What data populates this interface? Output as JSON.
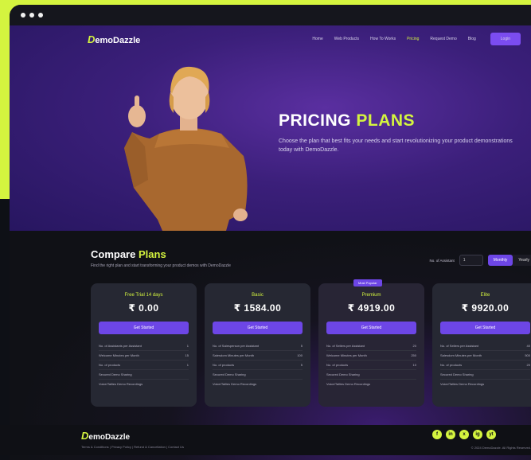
{
  "brand": {
    "logo_d": "D",
    "logo_rest": "emoDazzle"
  },
  "nav": {
    "links": [
      "Home",
      "Web Products",
      "How To Works",
      "Pricing",
      "Request Demo",
      "Blog"
    ],
    "login": "Login"
  },
  "hero": {
    "title_main": "PRICING",
    "title_accent": "PLANS",
    "subtitle": "Choose the plan that best fits your needs and start revolutionizing your product demonstrations today with DemoDazzle."
  },
  "compare": {
    "title_main": "Compare",
    "title_accent": "Plans",
    "subtitle": "Find the right plan and start transforming your product demos with DemoDazzle",
    "assistants_label": "No. of Assistant",
    "assistants_value": "1",
    "toggle": [
      "Monthly",
      "Yearly"
    ]
  },
  "plans": [
    {
      "name": "Free Trial 14 days",
      "price": "₹ 0.00",
      "cta": "Get Started",
      "features": [
        [
          "No. of Assistants per Assistant",
          "1"
        ],
        [
          "Welcome Minutes per Month",
          "15"
        ],
        [
          "No. of products",
          "1"
        ],
        [
          "Secured Demo Sharing",
          ""
        ],
        [
          "Voice/Tallies Demo Recordings",
          ""
        ]
      ]
    },
    {
      "name": "Basic",
      "price": "₹ 1584.00",
      "cta": "Get Started",
      "features": [
        [
          "No. of Salesperson per Assistant",
          "5"
        ],
        [
          "Salesdom Minutes per Month",
          "100"
        ],
        [
          "No. of products",
          "5"
        ],
        [
          "Secured Demo Sharing",
          ""
        ],
        [
          "Voice/Tallies Demo Recordings",
          ""
        ]
      ]
    },
    {
      "name": "Premium",
      "price": "₹ 4919.00",
      "cta": "Get Started",
      "badge": "Most Popular",
      "features": [
        [
          "No. of Sellers per Assistant",
          "20"
        ],
        [
          "Welcome Minutes per Month",
          "250"
        ],
        [
          "No. of products",
          "10"
        ],
        [
          "Secured Demo Sharing",
          ""
        ],
        [
          "Voice/Tallies Demo Recordings",
          ""
        ]
      ]
    },
    {
      "name": "Elite",
      "price": "₹ 9920.00",
      "cta": "Get Started",
      "features": [
        [
          "No. of Sellers per Assistant",
          "40"
        ],
        [
          "Salesdom Minutes per Month",
          "500"
        ],
        [
          "No. of products",
          "20"
        ],
        [
          "Secured Demo Sharing",
          ""
        ],
        [
          "Voice/Tallies Demo Recordings",
          ""
        ]
      ]
    }
  ],
  "footer": {
    "links": "Terms & Conditions  |  Privacy Policy  |  Refund & Cancellation  |  Contact Us",
    "copyright": "© 2024 DemoDazzle. All Rights Reserved.",
    "socials": [
      "f",
      "in",
      "x",
      "ig",
      "yt"
    ]
  },
  "colors": {
    "accent": "#d4f43f",
    "purple": "#6d46e6",
    "hero_bg": "#3b1f7a"
  }
}
